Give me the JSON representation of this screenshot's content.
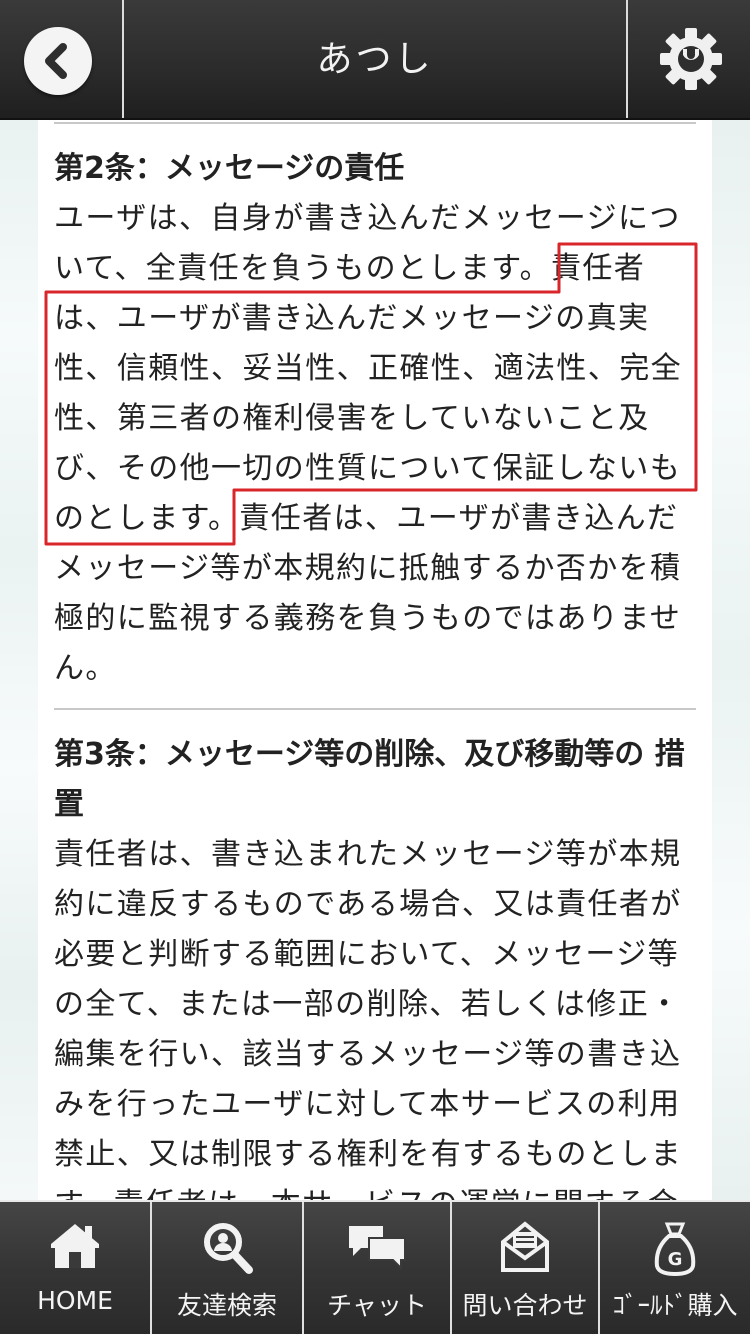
{
  "header": {
    "title": "あつし",
    "back_icon": "chevron-left-icon",
    "settings_icon": "gear-icon"
  },
  "articles": [
    {
      "heading_lines": [
        "第2条：メッセージの責任"
      ],
      "lines": [
        "ユーザは、自身が書き込んだメッセージにつ",
        "いて、全責任を負うものとします。責任者",
        "は、ユーザが書き込んだメッセージの真実",
        "性、信頼性、妥当性、正確性、適法性、完全",
        "性、第三者の権利侵害をしていないこと及",
        "び、その他一切の性質について保証しないも",
        "のとします。責任者は、ユーザが書き込んだ",
        "メッセージ等が本規約に抵触するか否かを積",
        "極的に監視する義務を負うものではありませ",
        "ん。"
      ]
    },
    {
      "heading_lines": [
        "第3条：メッセージ等の削除、及び移動等の",
        "措置"
      ],
      "lines": [
        "責任者は、書き込まれたメッセージ等が本規",
        "約に違反するものである場合、又は責任者が",
        "必要と判断する範囲において、メッセージ等",
        "の全て、または一部の削除、若しくは修正・",
        "編集を行い、該当するメッセージ等の書き込",
        "みを行ったユーザに対して本サービスの利用",
        "禁止、又は制限する権利を有するものとしま",
        "す。責任者は、本サービスの運営に関する合"
      ]
    }
  ],
  "highlight_color": "#d9262b",
  "tabs": [
    {
      "label": "HOME",
      "icon": "home-icon"
    },
    {
      "label": "友達検索",
      "icon": "search-person-icon"
    },
    {
      "label": "チャット",
      "icon": "chat-bubbles-icon"
    },
    {
      "label": "問い合わせ",
      "icon": "envelope-icon"
    },
    {
      "label": "ｺﾞｰﾙﾄﾞ購入",
      "icon": "gold-bag-icon"
    }
  ]
}
